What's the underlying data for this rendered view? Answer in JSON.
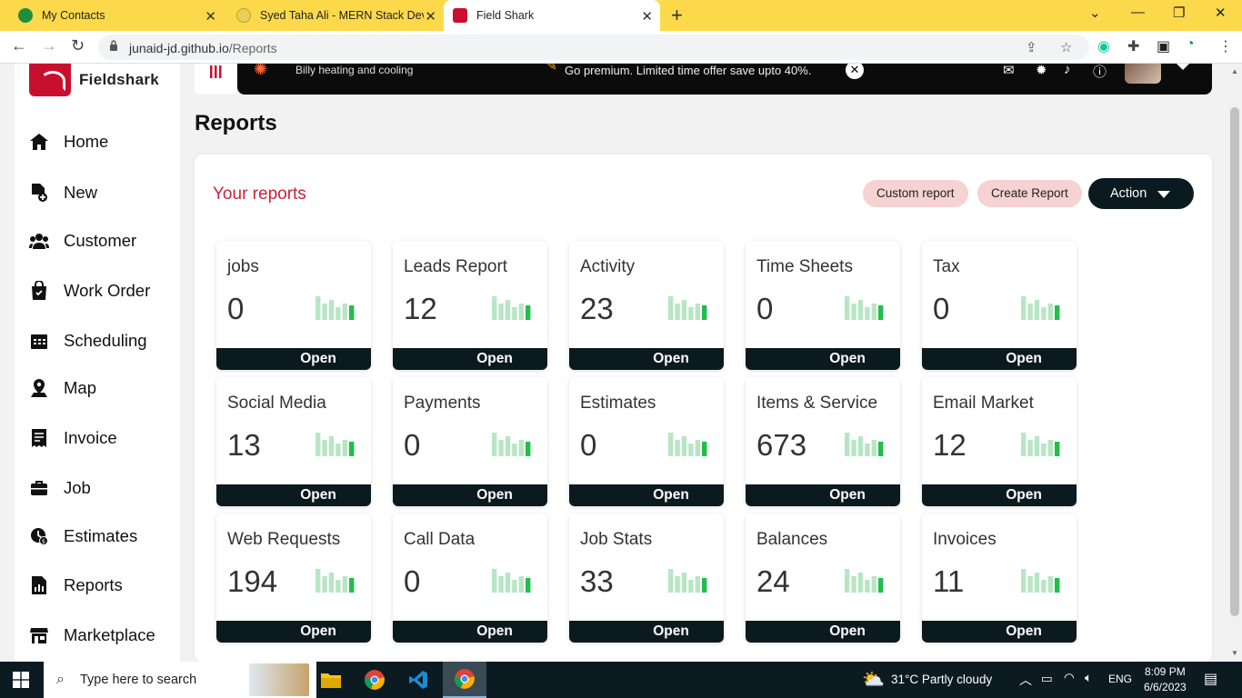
{
  "browser": {
    "tabs": [
      {
        "title": "My Contacts",
        "favicon_color": "#1e8e3e",
        "active": false
      },
      {
        "title": "Syed Taha Ali - MERN Stack Deve",
        "favicon_color": "#e8d15a",
        "active": false
      },
      {
        "title": "Field Shark",
        "favicon_color": "#c8102e",
        "active": true
      }
    ],
    "new_tab": "+",
    "url_host": "junaid-jd.github.io",
    "url_path": "/Reports"
  },
  "sidebar": {
    "logo_text": "Fieldshark",
    "items": [
      {
        "label": "Home",
        "icon": "home-icon"
      },
      {
        "label": "New",
        "icon": "new-document-icon"
      },
      {
        "label": "Customer",
        "icon": "customers-icon"
      },
      {
        "label": "Work Order",
        "icon": "shopping-bag-icon"
      },
      {
        "label": "Scheduling",
        "icon": "calendar-icon"
      },
      {
        "label": "Map",
        "icon": "map-pin-icon"
      },
      {
        "label": "Invoice",
        "icon": "receipt-icon"
      },
      {
        "label": "Job",
        "icon": "briefcase-icon"
      },
      {
        "label": "Estimates",
        "icon": "estimate-icon"
      },
      {
        "label": "Reports",
        "icon": "report-icon"
      },
      {
        "label": "Marketplace",
        "icon": "store-icon"
      }
    ]
  },
  "banner": {
    "brand": "Billy heating and cooling",
    "promo": "Go premium. Limited time offer save upto 40%.",
    "close": "✕"
  },
  "page": {
    "title": "Reports",
    "section_title": "Your reports",
    "buttons": {
      "custom_report": "Custom report",
      "create_report": "Create Report",
      "action": "Action"
    }
  },
  "reports": [
    {
      "title": "jobs",
      "value": "0",
      "open": "Open"
    },
    {
      "title": "Leads Report",
      "value": "12",
      "open": "Open"
    },
    {
      "title": "Activity",
      "value": "23",
      "open": "Open"
    },
    {
      "title": "Time Sheets",
      "value": "0",
      "open": "Open"
    },
    {
      "title": "Tax",
      "value": "0",
      "open": "Open"
    },
    {
      "title": "Social Media",
      "value": "13",
      "open": "Open"
    },
    {
      "title": "Payments",
      "value": "0",
      "open": "Open"
    },
    {
      "title": "Estimates",
      "value": "0",
      "open": "Open"
    },
    {
      "title": "Items & Service",
      "value": "673",
      "open": "Open"
    },
    {
      "title": "Email Market",
      "value": "12",
      "open": "Open"
    },
    {
      "title": "Web Requests",
      "value": "194",
      "open": "Open"
    },
    {
      "title": "Call Data",
      "value": "0",
      "open": "Open"
    },
    {
      "title": "Job Stats",
      "value": "33",
      "open": "Open"
    },
    {
      "title": "Balances",
      "value": "24",
      "open": "Open"
    },
    {
      "title": "Invoices",
      "value": "11",
      "open": "Open"
    }
  ],
  "colors": {
    "accent_red": "#c8233c",
    "dark": "#0b1a1f",
    "pill": "#f6d2d2",
    "spark_light": "#b8e6c4",
    "spark_dark": "#1fbf4a",
    "tabbar": "#fbd94b"
  },
  "taskbar": {
    "search_placeholder": "Type here to search",
    "weather": "31°C  Partly cloudy",
    "language": "ENG",
    "time": "8:09 PM",
    "date": "6/6/2023"
  }
}
